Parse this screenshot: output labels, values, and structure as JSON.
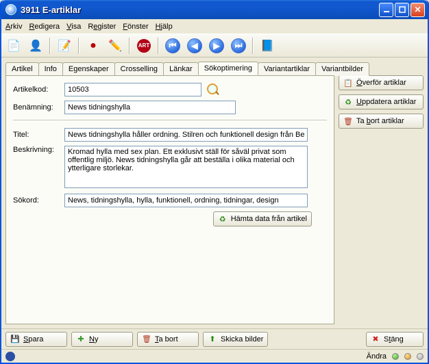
{
  "window": {
    "title": "3911 E-artiklar"
  },
  "menu": {
    "arkiv": "Arkiv",
    "redigera": "Redigera",
    "visa": "Visa",
    "register": "Register",
    "fonster": "Fönster",
    "hjalp": "Hjälp"
  },
  "tabs": {
    "artikel": "Artikel",
    "info": "Info",
    "egenskaper": "Egenskaper",
    "crosselling": "Crosselling",
    "lankar": "Länkar",
    "sokoptimering": "Sökoptimering",
    "variantartiklar": "Variantartiklar",
    "variantbilder": "Variantbilder"
  },
  "fields": {
    "artikelkod_label": "Artikelkod:",
    "artikelkod_value": "10503",
    "benamning_label": "Benämning:",
    "benamning_value": "News tidningshylla",
    "titel_label": "Titel:",
    "titel_value": "News tidningshylla håller ordning. Stilren och funktionell design från Bec",
    "beskrivning_label": "Beskrivning:",
    "beskrivning_value": "Kromad hylla med sex plan. Ett exklusivt ställ för såväl privat som offentlig miljö. News tidningshylla går att beställa i olika material och ytterligare storlekar.",
    "sokord_label": "Sökord:",
    "sokord_value": "News, tidningshylla, hylla, funktionell, ordning, tidningar, design"
  },
  "buttons": {
    "hamta": "Hämta data från artikel",
    "overfor": "Överför artiklar",
    "uppdatera": "Uppdatera artiklar",
    "tabort_artiklar": "Ta bort artiklar",
    "spara": "Spara",
    "ny": "Ny",
    "tabort": "Ta bort",
    "skicka": "Skicka bilder",
    "stang": "Stäng"
  },
  "status": {
    "andra": "Ändra"
  }
}
